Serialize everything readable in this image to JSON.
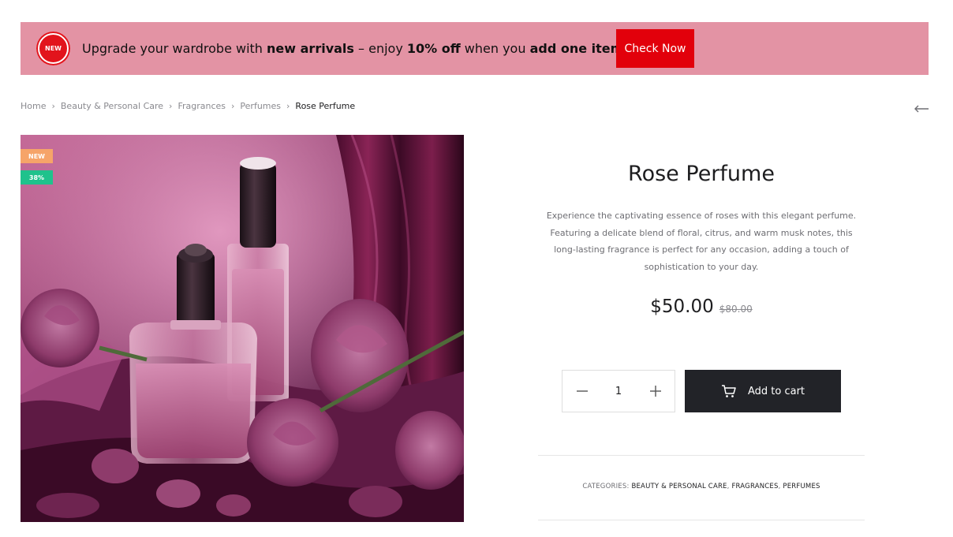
{
  "banner": {
    "badge": "NEW",
    "text_1": "Upgrade your wardrobe with ",
    "bold_1": "new arrivals",
    "text_2": " – enjoy ",
    "bold_2": "10% off",
    "text_3": " when you ",
    "bold_3": "add one item!",
    "button_label": "Check Now"
  },
  "breadcrumb": {
    "items": [
      "Home",
      "Beauty & Personal Care",
      "Fragrances",
      "Perfumes"
    ],
    "current": "Rose Perfume",
    "separator": "›"
  },
  "product": {
    "badges": {
      "new": "NEW",
      "discount": "38%"
    },
    "title": "Rose Perfume",
    "description": "Experience the captivating essence of roses with this elegant perfume. Featuring a delicate blend of floral, citrus, and warm musk notes, this long-lasting fragrance is perfect for any occasion, adding a touch of sophistication to your day.",
    "price": "$50.00",
    "old_price": "$80.00",
    "quantity": "1",
    "add_to_cart_label": "Add to cart",
    "categories_label": "CATEGORIES:",
    "categories": [
      "BEAUTY & PERSONAL CARE",
      "FRAGRANCES",
      "PERFUMES"
    ]
  },
  "colors": {
    "banner_bg": "#e393a4",
    "accent_red": "#e2000b",
    "badge_new": "#f6a469",
    "badge_discount": "#1fc28c",
    "cart_button": "#222328"
  },
  "icons": [
    "new-badge-icon",
    "chevron-right-icon",
    "arrow-left-icon",
    "minus-icon",
    "plus-icon",
    "cart-icon"
  ]
}
